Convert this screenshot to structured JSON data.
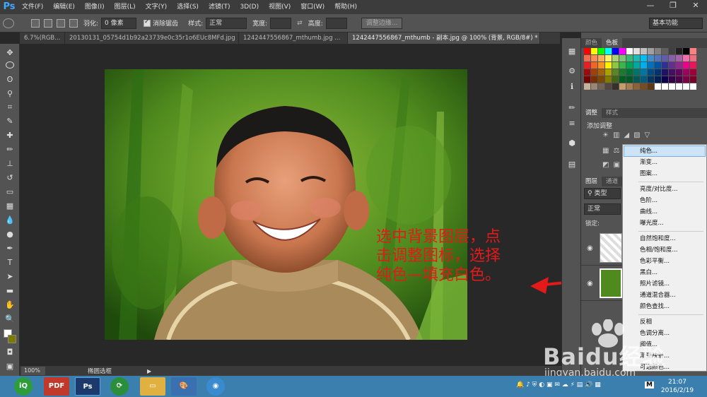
{
  "app": {
    "logo": "Ps"
  },
  "menu": [
    "文件(F)",
    "编辑(E)",
    "图像(I)",
    "图层(L)",
    "文字(Y)",
    "选择(S)",
    "滤镜(T)",
    "3D(D)",
    "视图(V)",
    "窗口(W)",
    "帮助(H)"
  ],
  "options": {
    "feather_label": "羽化:",
    "feather_value": "0 像素",
    "antialias_label": "消除锯齿",
    "style_label": "样式:",
    "style_value": "正常",
    "width_label": "宽度:",
    "height_label": "高度:",
    "refine_edge": "调整边缘...",
    "workspace": "基本功能"
  },
  "tabs": [
    "6.7%(RGB...",
    "20130131_05754d1b92a23739e0c35r1o6EUc8MFd.jpg",
    "1242447556867_mthumb.jpg ...",
    "1242447556867_mthumb - 副本.jpg @ 100% (背景, RGB/8#) *"
  ],
  "status": {
    "zoom": "100%",
    "doc": "椭圆选框"
  },
  "panels": {
    "color_tab": "颜色",
    "swatch_tab": "色板",
    "adjust_tab": "调整",
    "style_tab": "样式",
    "add_adjustment": "添加调整",
    "layers_tab": "图层",
    "channels_tab": "通道",
    "kind_label": "类型",
    "blend_mode": "正常",
    "lock_label": "锁定:"
  },
  "dropdown": [
    "纯色...",
    "渐变...",
    "图案...",
    "亮度/对比度...",
    "色阶...",
    "曲线...",
    "曝光度...",
    "自然饱和度...",
    "色相/饱和度...",
    "色彩平衡...",
    "黑白...",
    "照片滤镜...",
    "通道混合器...",
    "颜色查找...",
    "反相",
    "色调分离...",
    "阈值...",
    "渐变映射...",
    "可选颜色..."
  ],
  "annotation": [
    "选中背景图层，点",
    "击调整图标，选择",
    "纯色—填充白色。"
  ],
  "watermark": {
    "brand": "Baidu经验",
    "url": "jingyan.baidu.com"
  },
  "taskbar": {
    "time": "21:07",
    "date": "2016/2/19",
    "pdf_label": "PDF",
    "ps_label": "Ps"
  },
  "colors": {
    "accent_red": "#e21a1a",
    "taskbar": "#3b7fae",
    "panel": "#535353"
  }
}
